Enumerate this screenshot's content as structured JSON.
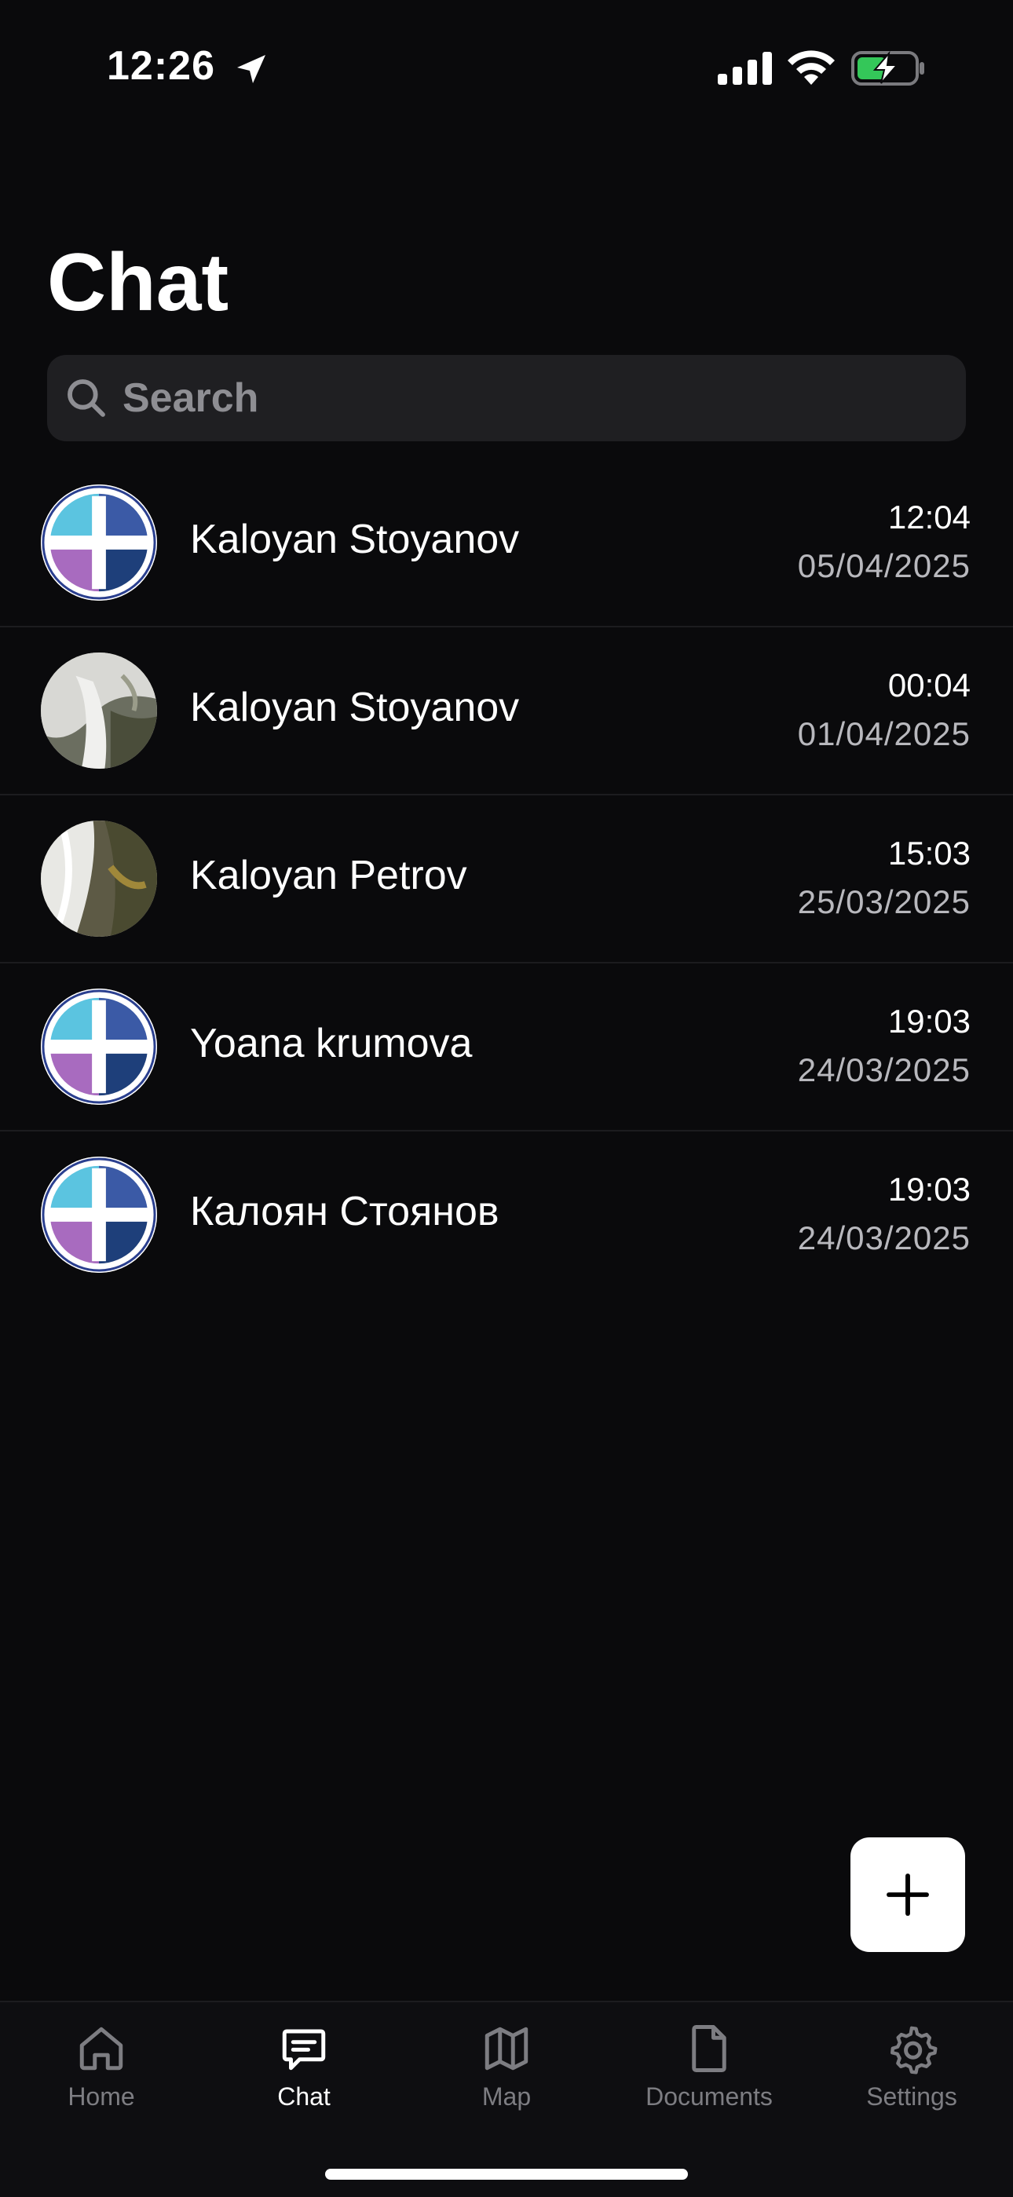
{
  "status_bar": {
    "time": "12:26"
  },
  "page": {
    "title": "Chat"
  },
  "search": {
    "placeholder": "Search"
  },
  "chats": [
    {
      "name": "Kaloyan Stoyanov",
      "time": "12:04",
      "date": "05/04/2025",
      "avatar": "logo"
    },
    {
      "name": "Kaloyan Stoyanov",
      "time": "00:04",
      "date": "01/04/2025",
      "avatar": "photo"
    },
    {
      "name": "Kaloyan Petrov",
      "time": "15:03",
      "date": "25/03/2025",
      "avatar": "photo"
    },
    {
      "name": "Yoana krumova",
      "time": "19:03",
      "date": "24/03/2025",
      "avatar": "logo"
    },
    {
      "name": "Калоян Стоянов",
      "time": "19:03",
      "date": "24/03/2025",
      "avatar": "logo"
    }
  ],
  "tab_bar": {
    "tabs": [
      {
        "label": "Home",
        "icon": "home-icon",
        "active": false
      },
      {
        "label": "Chat",
        "icon": "chat-icon",
        "active": true
      },
      {
        "label": "Map",
        "icon": "map-icon",
        "active": false
      },
      {
        "label": "Documents",
        "icon": "document-icon",
        "active": false
      },
      {
        "label": "Settings",
        "icon": "gear-icon",
        "active": false
      }
    ]
  },
  "colors": {
    "background": "#0a0a0c",
    "search_bg": "#1f1f22",
    "inactive_tab": "#7d7d82",
    "battery_charging": "#34c759"
  }
}
